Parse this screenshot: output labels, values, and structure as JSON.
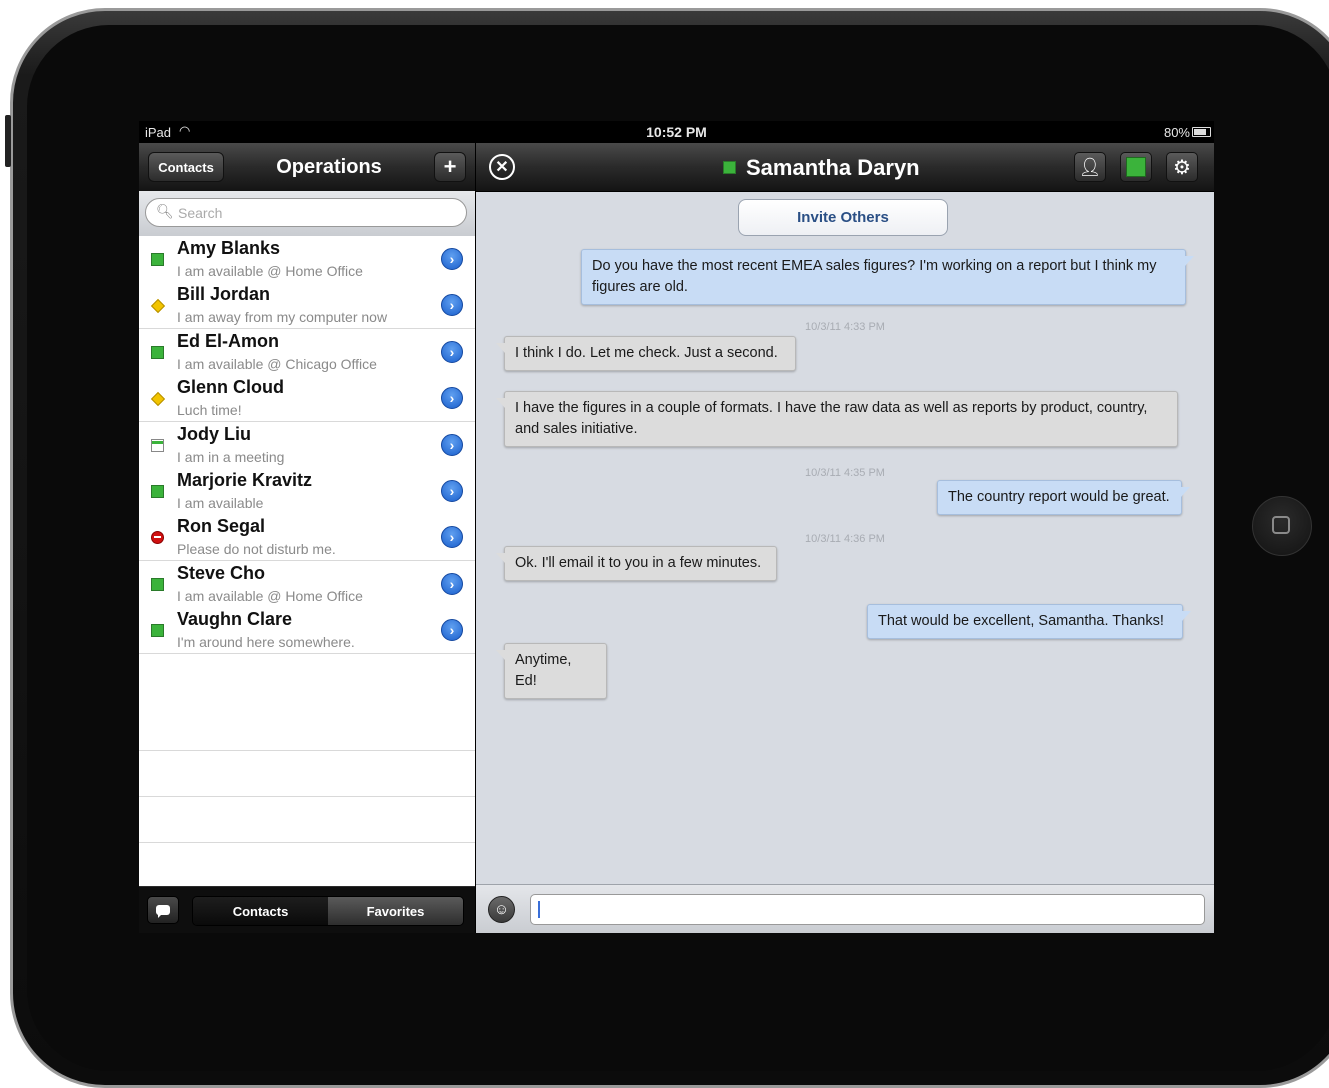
{
  "status_bar": {
    "carrier": "iPad",
    "time": "10:52 PM",
    "battery": "80%"
  },
  "left_pane": {
    "back_label": "Contacts",
    "title": "Operations",
    "add_label": "+",
    "search_placeholder": "Search",
    "contacts": [
      {
        "name": "Amy Blanks",
        "message": "I am available @ Home Office",
        "status": "available"
      },
      {
        "name": "Bill Jordan",
        "message": "I am away from my computer now",
        "status": "away"
      },
      {
        "name": "Ed El-Amon",
        "message": "I am available @ Chicago Office",
        "status": "available"
      },
      {
        "name": "Glenn Cloud",
        "message": "Luch time!",
        "status": "away"
      },
      {
        "name": "Jody Liu",
        "message": "I am in a meeting",
        "status": "meeting"
      },
      {
        "name": "Marjorie Kravitz",
        "message": "I am available",
        "status": "available"
      },
      {
        "name": "Ron Segal",
        "message": "Please do not disturb me.",
        "status": "do-not-disturb"
      },
      {
        "name": "Steve Cho",
        "message": "I am available @ Home Office",
        "status": "available"
      },
      {
        "name": "Vaughn Clare",
        "message": "I'm around here somewhere.",
        "status": "available"
      }
    ],
    "tabs": {
      "contacts": "Contacts",
      "favorites": "Favorites"
    }
  },
  "chat": {
    "title": "Samantha Daryn",
    "status": "available",
    "invite_label": "Invite Others",
    "messages": [
      {
        "direction": "out",
        "text": "Do you have the most recent EMEA sales figures? I'm working on a report but I think my figures are old."
      },
      {
        "timestamp": "10/3/11 4:33 PM"
      },
      {
        "direction": "in",
        "text": "I think I do. Let me check. Just a second."
      },
      {
        "direction": "in",
        "text": "I have the figures in a couple of formats. I have the raw data as well as reports by product, country, and sales initiative."
      },
      {
        "timestamp": "10/3/11 4:35 PM"
      },
      {
        "direction": "out",
        "text": "The country report would be great."
      },
      {
        "timestamp": "10/3/11 4:36 PM"
      },
      {
        "direction": "in",
        "text": "Ok. I'll email it to you in a few minutes."
      },
      {
        "direction": "out",
        "text": "That would be excellent, Samantha. Thanks!"
      },
      {
        "direction": "in",
        "text": "Anytime, Ed!"
      }
    ],
    "input_value": ""
  },
  "colors": {
    "available": "#3bb33b",
    "away": "#f2c400",
    "busy": "#d01010",
    "outgoing_bubble": "#c8dcf5",
    "incoming_bubble": "#dcdcdc",
    "accent": "#1a5fcc"
  },
  "icons": {
    "search": "search-icon",
    "add": "plus-icon",
    "close": "close-circle-icon",
    "person": "person-icon",
    "settings": "gear-icon",
    "chat": "chat-bubble-icon",
    "emoji": "smiley-icon",
    "disclosure": "chevron-right-icon"
  }
}
